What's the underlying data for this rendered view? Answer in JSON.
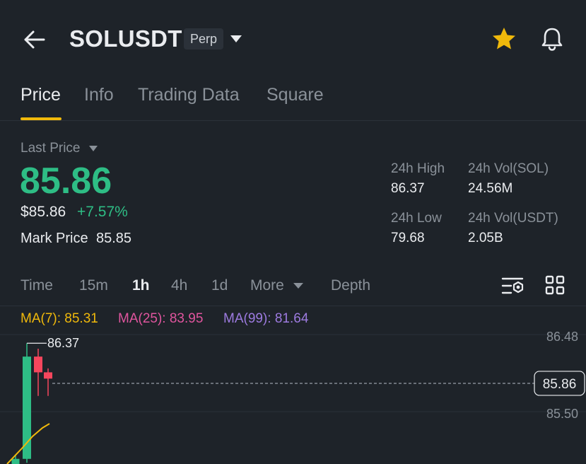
{
  "header": {
    "symbol": "SOLUSDT",
    "badge": "Perp"
  },
  "tabs": [
    {
      "label": "Price",
      "active": true
    },
    {
      "label": "Info",
      "active": false
    },
    {
      "label": "Trading Data",
      "active": false
    },
    {
      "label": "Square",
      "active": false
    }
  ],
  "price": {
    "last_price_label": "Last Price",
    "last_price": "85.86",
    "usd_price": "$85.86",
    "change": "+7.57%",
    "mark_price_label": "Mark Price",
    "mark_price": "85.85"
  },
  "stats": {
    "high_label": "24h High",
    "high": "86.37",
    "vol_sol_label": "24h Vol(SOL)",
    "vol_sol": "24.56M",
    "low_label": "24h Low",
    "low": "79.68",
    "vol_usdt_label": "24h Vol(USDT)",
    "vol_usdt": "2.05B"
  },
  "intervals": [
    {
      "label": "Time",
      "active": false
    },
    {
      "label": "15m",
      "active": false
    },
    {
      "label": "1h",
      "active": true
    },
    {
      "label": "4h",
      "active": false
    },
    {
      "label": "1d",
      "active": false
    },
    {
      "label": "More",
      "active": false
    },
    {
      "label": "Depth",
      "active": false
    }
  ],
  "ma": {
    "ma7": "MA(7): 85.31",
    "ma25": "MA(25): 83.95",
    "ma99": "MA(99): 81.64"
  },
  "colors": {
    "up": "#2ebd85",
    "down": "#f6465d",
    "accent": "#f0b90b",
    "ma7": "#f0b90b",
    "ma25": "#e0559e",
    "ma99": "#9d7be0"
  },
  "chart_data": {
    "type": "candlestick",
    "axis_labels": [
      "86.48",
      "85.50"
    ],
    "current_price_label": "85.86",
    "high_marker": "86.37",
    "candles": [
      {
        "open": 84.6,
        "close": 84.9,
        "high": 84.95,
        "low": 84.55,
        "direction": "up"
      },
      {
        "open": 84.9,
        "close": 86.2,
        "high": 86.37,
        "low": 84.85,
        "direction": "up"
      },
      {
        "open": 86.2,
        "close": 86.0,
        "high": 86.3,
        "low": 85.7,
        "direction": "down"
      },
      {
        "open": 86.0,
        "close": 85.92,
        "high": 86.05,
        "low": 85.7,
        "direction": "down"
      }
    ]
  }
}
